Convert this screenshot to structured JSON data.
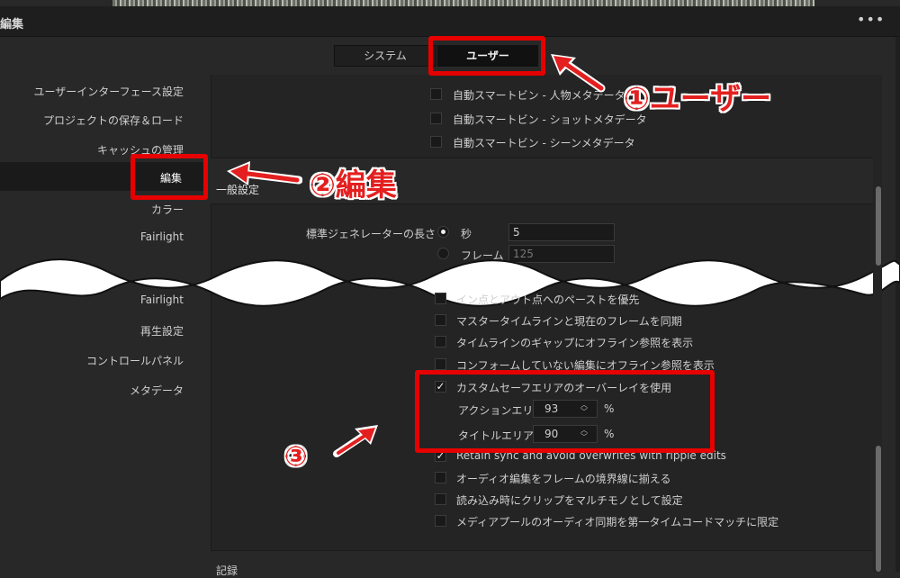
{
  "window": {
    "title": "編集",
    "menu_glyph": "•••"
  },
  "tabs": [
    {
      "label": "システム",
      "active": false
    },
    {
      "label": "ユーザー",
      "active": true
    }
  ],
  "sidebar": {
    "items": [
      {
        "label": "ユーザーインターフェース設定"
      },
      {
        "label": "プロジェクトの保存＆ロード"
      },
      {
        "label": "キャッシュの管理"
      },
      {
        "label": "編集",
        "selected": true
      },
      {
        "label": "カラー"
      },
      {
        "label": "Fairlight"
      },
      {
        "label": "Fairlight"
      },
      {
        "label": "再生設定"
      },
      {
        "label": "コントロールパネル"
      },
      {
        "label": "メタデータ"
      }
    ]
  },
  "top_panel": {
    "checkboxes": [
      {
        "label": "自動スマートビン - 人物メタデータ",
        "checked": false
      },
      {
        "label": "自動スマートビン - ショットメタデータ",
        "checked": false
      },
      {
        "label": "自動スマートビン - シーンメタデータ",
        "checked": false
      }
    ]
  },
  "general": {
    "section_title": "一般設定",
    "generator_length_label": "標準ジェネレーターの長さ",
    "radio_seconds": {
      "label": "秒",
      "value": "5",
      "selected": true
    },
    "radio_frames": {
      "label": "フレーム",
      "value": "125",
      "selected": false
    },
    "checkboxes": [
      {
        "label": "イン点とアウト点へのペーストを優先",
        "checked": false
      },
      {
        "label": "マスタータイムラインと現在のフレームを同期",
        "checked": false
      },
      {
        "label": "タイムラインのギャップにオフライン参照を表示",
        "checked": false
      },
      {
        "label": "コンフォームしていない編集にオフライン参照を表示",
        "checked": false
      },
      {
        "label": "カスタムセーフエリアのオーバーレイを使用",
        "checked": true
      }
    ],
    "action_area": {
      "label": "アクションエリア",
      "value": "93",
      "unit": "%"
    },
    "title_area": {
      "label": "タイトルエリア",
      "value": "90",
      "unit": "%"
    },
    "checkboxes_after": [
      {
        "label": "Retain sync and avoid overwrites with ripple edits",
        "checked": true
      },
      {
        "label": "オーディオ編集をフレームの境界線に揃える",
        "checked": false
      },
      {
        "label": "読み込み時にクリップをマルチモノとして設定",
        "checked": false
      },
      {
        "label": "メディアプールのオーディオ同期を第一タイムコードマッチに限定",
        "checked": false
      }
    ],
    "next_section_partial": "記録"
  },
  "annotations": {
    "a1": "①ユーザー",
    "a2": "②編集",
    "a3": "③"
  },
  "colors": {
    "annotation_red": "#e41f1f",
    "panel_bg": "#242424",
    "window_bg": "#282828"
  }
}
